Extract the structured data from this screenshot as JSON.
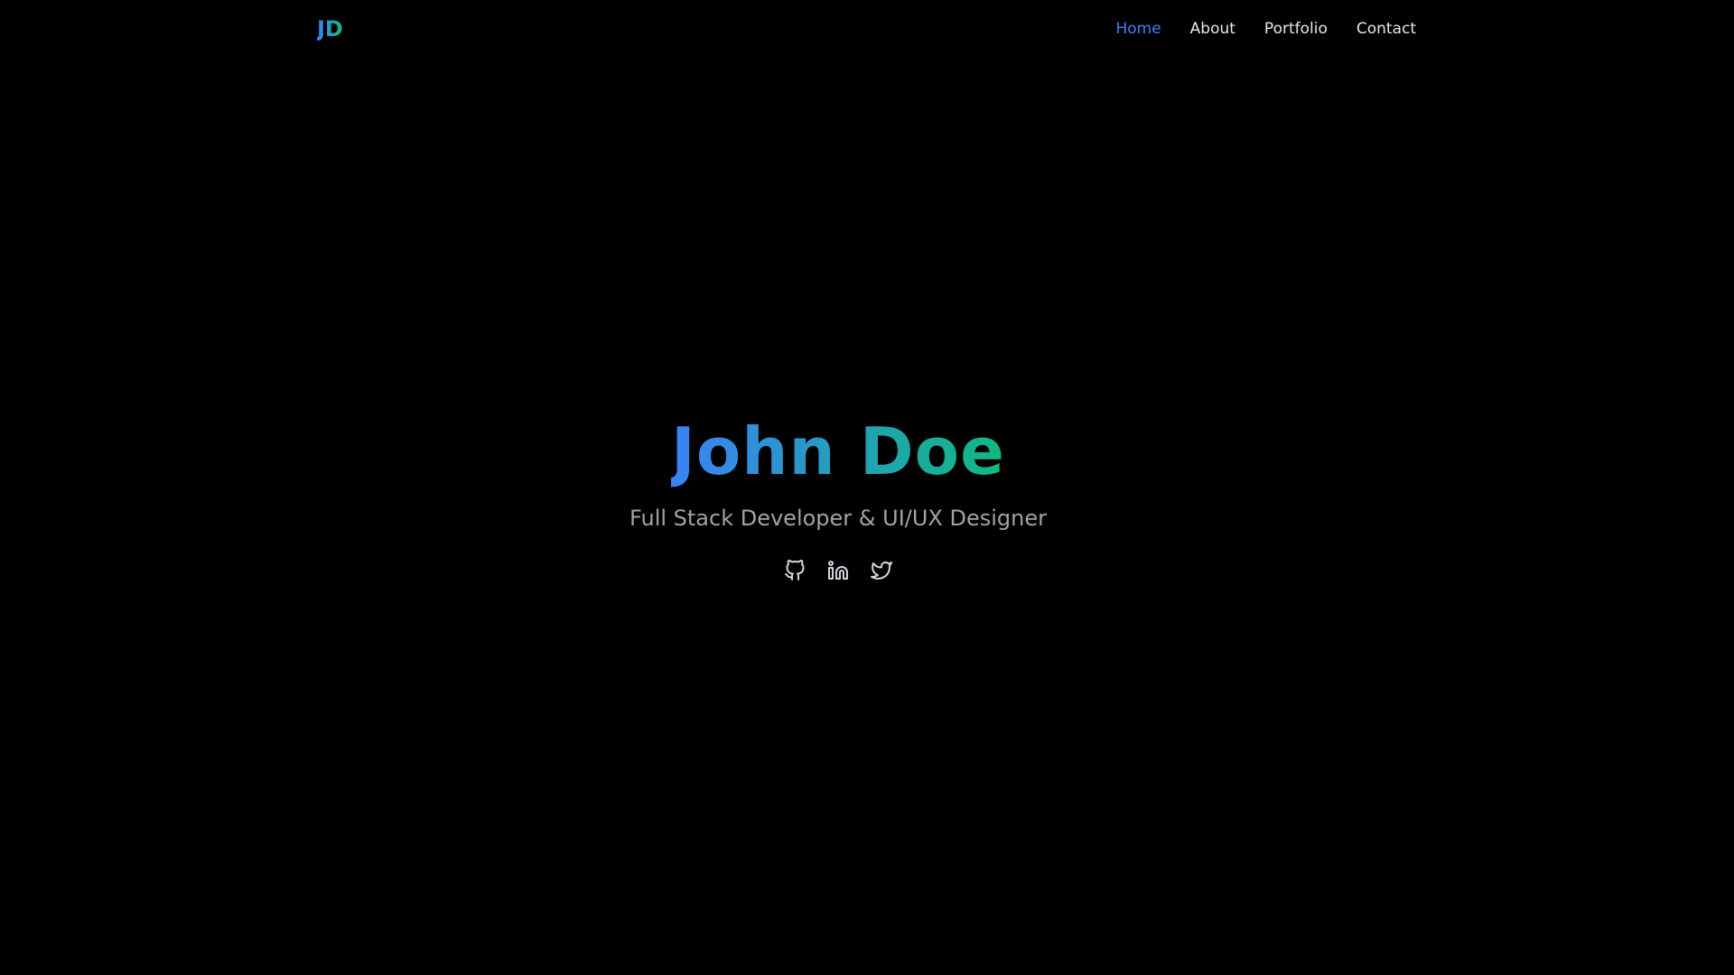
{
  "header": {
    "logo_text": "JD",
    "nav": [
      {
        "label": "Home",
        "active": true
      },
      {
        "label": "About",
        "active": false
      },
      {
        "label": "Portfolio",
        "active": false
      },
      {
        "label": "Contact",
        "active": false
      }
    ]
  },
  "hero": {
    "name": "John Doe",
    "subtitle": "Full Stack Developer & UI/UX Designer",
    "social_icons": [
      "github-icon",
      "linkedin-icon",
      "twitter-icon"
    ]
  },
  "colors": {
    "background": "#000000",
    "accent_blue": "#3b82f6",
    "accent_green": "#10b981",
    "nav_text": "#e5e7eb",
    "subtitle_text": "#a3a3a3"
  }
}
